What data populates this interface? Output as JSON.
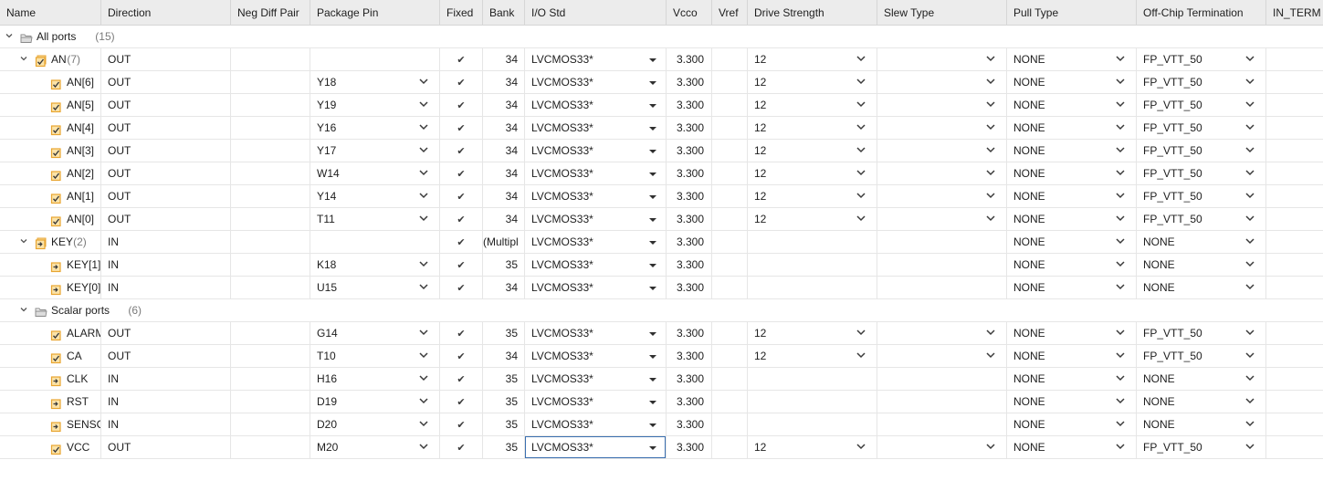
{
  "columns": [
    "Name",
    "Direction",
    "Neg Diff Pair",
    "Package Pin",
    "Fixed",
    "Bank",
    "I/O Std",
    "Vcco",
    "Vref",
    "Drive Strength",
    "Slew Type",
    "Pull Type",
    "Off-Chip Termination",
    "IN_TERM"
  ],
  "colors": {
    "header_bg": "#ececec",
    "border": "#d6d6d6",
    "icon_orange": "#e8a530",
    "icon_check": "#3a3a3a",
    "focus": "#3a6fb0"
  },
  "rows": [
    {
      "kind": "group",
      "level": 0,
      "name": "All ports",
      "count": "(15)",
      "icon": "folder-icon"
    },
    {
      "kind": "bus",
      "level": 1,
      "name": "AN",
      "count": "(7)",
      "icon": "output-bus-icon",
      "dir": "OUT",
      "pin": "",
      "fixed": "✔",
      "bank": "34",
      "iostd": "LVCMOS33*",
      "vcco": "3.300",
      "drive": "12",
      "slew": "",
      "pull": "NONE",
      "term": "FP_VTT_50",
      "pin_dd": false,
      "drive_dd": true,
      "slew_dd": true,
      "term_dd": true
    },
    {
      "kind": "port",
      "level": 2,
      "name": "AN[6]",
      "icon": "output-port-icon",
      "dir": "OUT",
      "pin": "Y18",
      "fixed": "✔",
      "bank": "34",
      "iostd": "LVCMOS33*",
      "vcco": "3.300",
      "drive": "12",
      "slew": "",
      "pull": "NONE",
      "term": "FP_VTT_50",
      "pin_dd": true,
      "drive_dd": true,
      "slew_dd": true,
      "term_dd": true
    },
    {
      "kind": "port",
      "level": 2,
      "name": "AN[5]",
      "icon": "output-port-icon",
      "dir": "OUT",
      "pin": "Y19",
      "fixed": "✔",
      "bank": "34",
      "iostd": "LVCMOS33*",
      "vcco": "3.300",
      "drive": "12",
      "slew": "",
      "pull": "NONE",
      "term": "FP_VTT_50",
      "pin_dd": true,
      "drive_dd": true,
      "slew_dd": true,
      "term_dd": true
    },
    {
      "kind": "port",
      "level": 2,
      "name": "AN[4]",
      "icon": "output-port-icon",
      "dir": "OUT",
      "pin": "Y16",
      "fixed": "✔",
      "bank": "34",
      "iostd": "LVCMOS33*",
      "vcco": "3.300",
      "drive": "12",
      "slew": "",
      "pull": "NONE",
      "term": "FP_VTT_50",
      "pin_dd": true,
      "drive_dd": true,
      "slew_dd": true,
      "term_dd": true
    },
    {
      "kind": "port",
      "level": 2,
      "name": "AN[3]",
      "icon": "output-port-icon",
      "dir": "OUT",
      "pin": "Y17",
      "fixed": "✔",
      "bank": "34",
      "iostd": "LVCMOS33*",
      "vcco": "3.300",
      "drive": "12",
      "slew": "",
      "pull": "NONE",
      "term": "FP_VTT_50",
      "pin_dd": true,
      "drive_dd": true,
      "slew_dd": true,
      "term_dd": true
    },
    {
      "kind": "port",
      "level": 2,
      "name": "AN[2]",
      "icon": "output-port-icon",
      "dir": "OUT",
      "pin": "W14",
      "fixed": "✔",
      "bank": "34",
      "iostd": "LVCMOS33*",
      "vcco": "3.300",
      "drive": "12",
      "slew": "",
      "pull": "NONE",
      "term": "FP_VTT_50",
      "pin_dd": true,
      "drive_dd": true,
      "slew_dd": true,
      "term_dd": true
    },
    {
      "kind": "port",
      "level": 2,
      "name": "AN[1]",
      "icon": "output-port-icon",
      "dir": "OUT",
      "pin": "Y14",
      "fixed": "✔",
      "bank": "34",
      "iostd": "LVCMOS33*",
      "vcco": "3.300",
      "drive": "12",
      "slew": "",
      "pull": "NONE",
      "term": "FP_VTT_50",
      "pin_dd": true,
      "drive_dd": true,
      "slew_dd": true,
      "term_dd": true
    },
    {
      "kind": "port",
      "level": 2,
      "name": "AN[0]",
      "icon": "output-port-icon",
      "dir": "OUT",
      "pin": "T11",
      "fixed": "✔",
      "bank": "34",
      "iostd": "LVCMOS33*",
      "vcco": "3.300",
      "drive": "12",
      "slew": "",
      "pull": "NONE",
      "term": "FP_VTT_50",
      "pin_dd": true,
      "drive_dd": true,
      "slew_dd": true,
      "term_dd": true
    },
    {
      "kind": "bus",
      "level": 1,
      "name": "KEY",
      "count": "(2)",
      "icon": "input-bus-icon",
      "dir": "IN",
      "pin": "",
      "fixed": "✔",
      "bank": "(Multipl",
      "iostd": "LVCMOS33*",
      "vcco": "3.300",
      "drive": "",
      "slew": "",
      "pull": "NONE",
      "term": "NONE",
      "pin_dd": false,
      "drive_dd": false,
      "slew_dd": false,
      "term_dd": true
    },
    {
      "kind": "port",
      "level": 2,
      "name": "KEY[1]",
      "icon": "input-port-icon",
      "dir": "IN",
      "pin": "K18",
      "fixed": "✔",
      "bank": "35",
      "iostd": "LVCMOS33*",
      "vcco": "3.300",
      "drive": "",
      "slew": "",
      "pull": "NONE",
      "term": "NONE",
      "pin_dd": true,
      "drive_dd": false,
      "slew_dd": false,
      "term_dd": true
    },
    {
      "kind": "port",
      "level": 2,
      "name": "KEY[0]",
      "icon": "input-port-icon",
      "dir": "IN",
      "pin": "U15",
      "fixed": "✔",
      "bank": "34",
      "iostd": "LVCMOS33*",
      "vcco": "3.300",
      "drive": "",
      "slew": "",
      "pull": "NONE",
      "term": "NONE",
      "pin_dd": true,
      "drive_dd": false,
      "slew_dd": false,
      "term_dd": true
    },
    {
      "kind": "group",
      "level": 1,
      "name": "Scalar ports",
      "count": "(6)",
      "icon": "folder-icon"
    },
    {
      "kind": "port",
      "level": 2,
      "name": "ALARM",
      "icon": "output-port-icon",
      "dir": "OUT",
      "pin": "G14",
      "fixed": "✔",
      "bank": "35",
      "iostd": "LVCMOS33*",
      "vcco": "3.300",
      "drive": "12",
      "slew": "",
      "pull": "NONE",
      "term": "FP_VTT_50",
      "pin_dd": true,
      "drive_dd": true,
      "slew_dd": true,
      "term_dd": true
    },
    {
      "kind": "port",
      "level": 2,
      "name": "CA",
      "icon": "output-port-icon",
      "dir": "OUT",
      "pin": "T10",
      "fixed": "✔",
      "bank": "34",
      "iostd": "LVCMOS33*",
      "vcco": "3.300",
      "drive": "12",
      "slew": "",
      "pull": "NONE",
      "term": "FP_VTT_50",
      "pin_dd": true,
      "drive_dd": true,
      "slew_dd": true,
      "term_dd": true
    },
    {
      "kind": "port",
      "level": 2,
      "name": "CLK",
      "icon": "input-port-icon",
      "dir": "IN",
      "pin": "H16",
      "fixed": "✔",
      "bank": "35",
      "iostd": "LVCMOS33*",
      "vcco": "3.300",
      "drive": "",
      "slew": "",
      "pull": "NONE",
      "term": "NONE",
      "pin_dd": true,
      "drive_dd": false,
      "slew_dd": false,
      "term_dd": true
    },
    {
      "kind": "port",
      "level": 2,
      "name": "RST",
      "icon": "input-port-icon",
      "dir": "IN",
      "pin": "D19",
      "fixed": "✔",
      "bank": "35",
      "iostd": "LVCMOS33*",
      "vcco": "3.300",
      "drive": "",
      "slew": "",
      "pull": "NONE",
      "term": "NONE",
      "pin_dd": true,
      "drive_dd": false,
      "slew_dd": false,
      "term_dd": true
    },
    {
      "kind": "port",
      "level": 2,
      "name": "SENSO",
      "icon": "input-port-icon",
      "dir": "IN",
      "pin": "D20",
      "fixed": "✔",
      "bank": "35",
      "iostd": "LVCMOS33*",
      "vcco": "3.300",
      "drive": "",
      "slew": "",
      "pull": "NONE",
      "term": "NONE",
      "pin_dd": true,
      "drive_dd": false,
      "slew_dd": false,
      "term_dd": true
    },
    {
      "kind": "port",
      "level": 2,
      "name": "VCC",
      "icon": "output-port-icon",
      "dir": "OUT",
      "pin": "M20",
      "fixed": "✔",
      "bank": "35",
      "iostd": "LVCMOS33*",
      "vcco": "3.300",
      "drive": "12",
      "slew": "",
      "pull": "NONE",
      "term": "FP_VTT_50",
      "pin_dd": true,
      "drive_dd": true,
      "slew_dd": true,
      "term_dd": true,
      "iostd_focused": true
    }
  ]
}
